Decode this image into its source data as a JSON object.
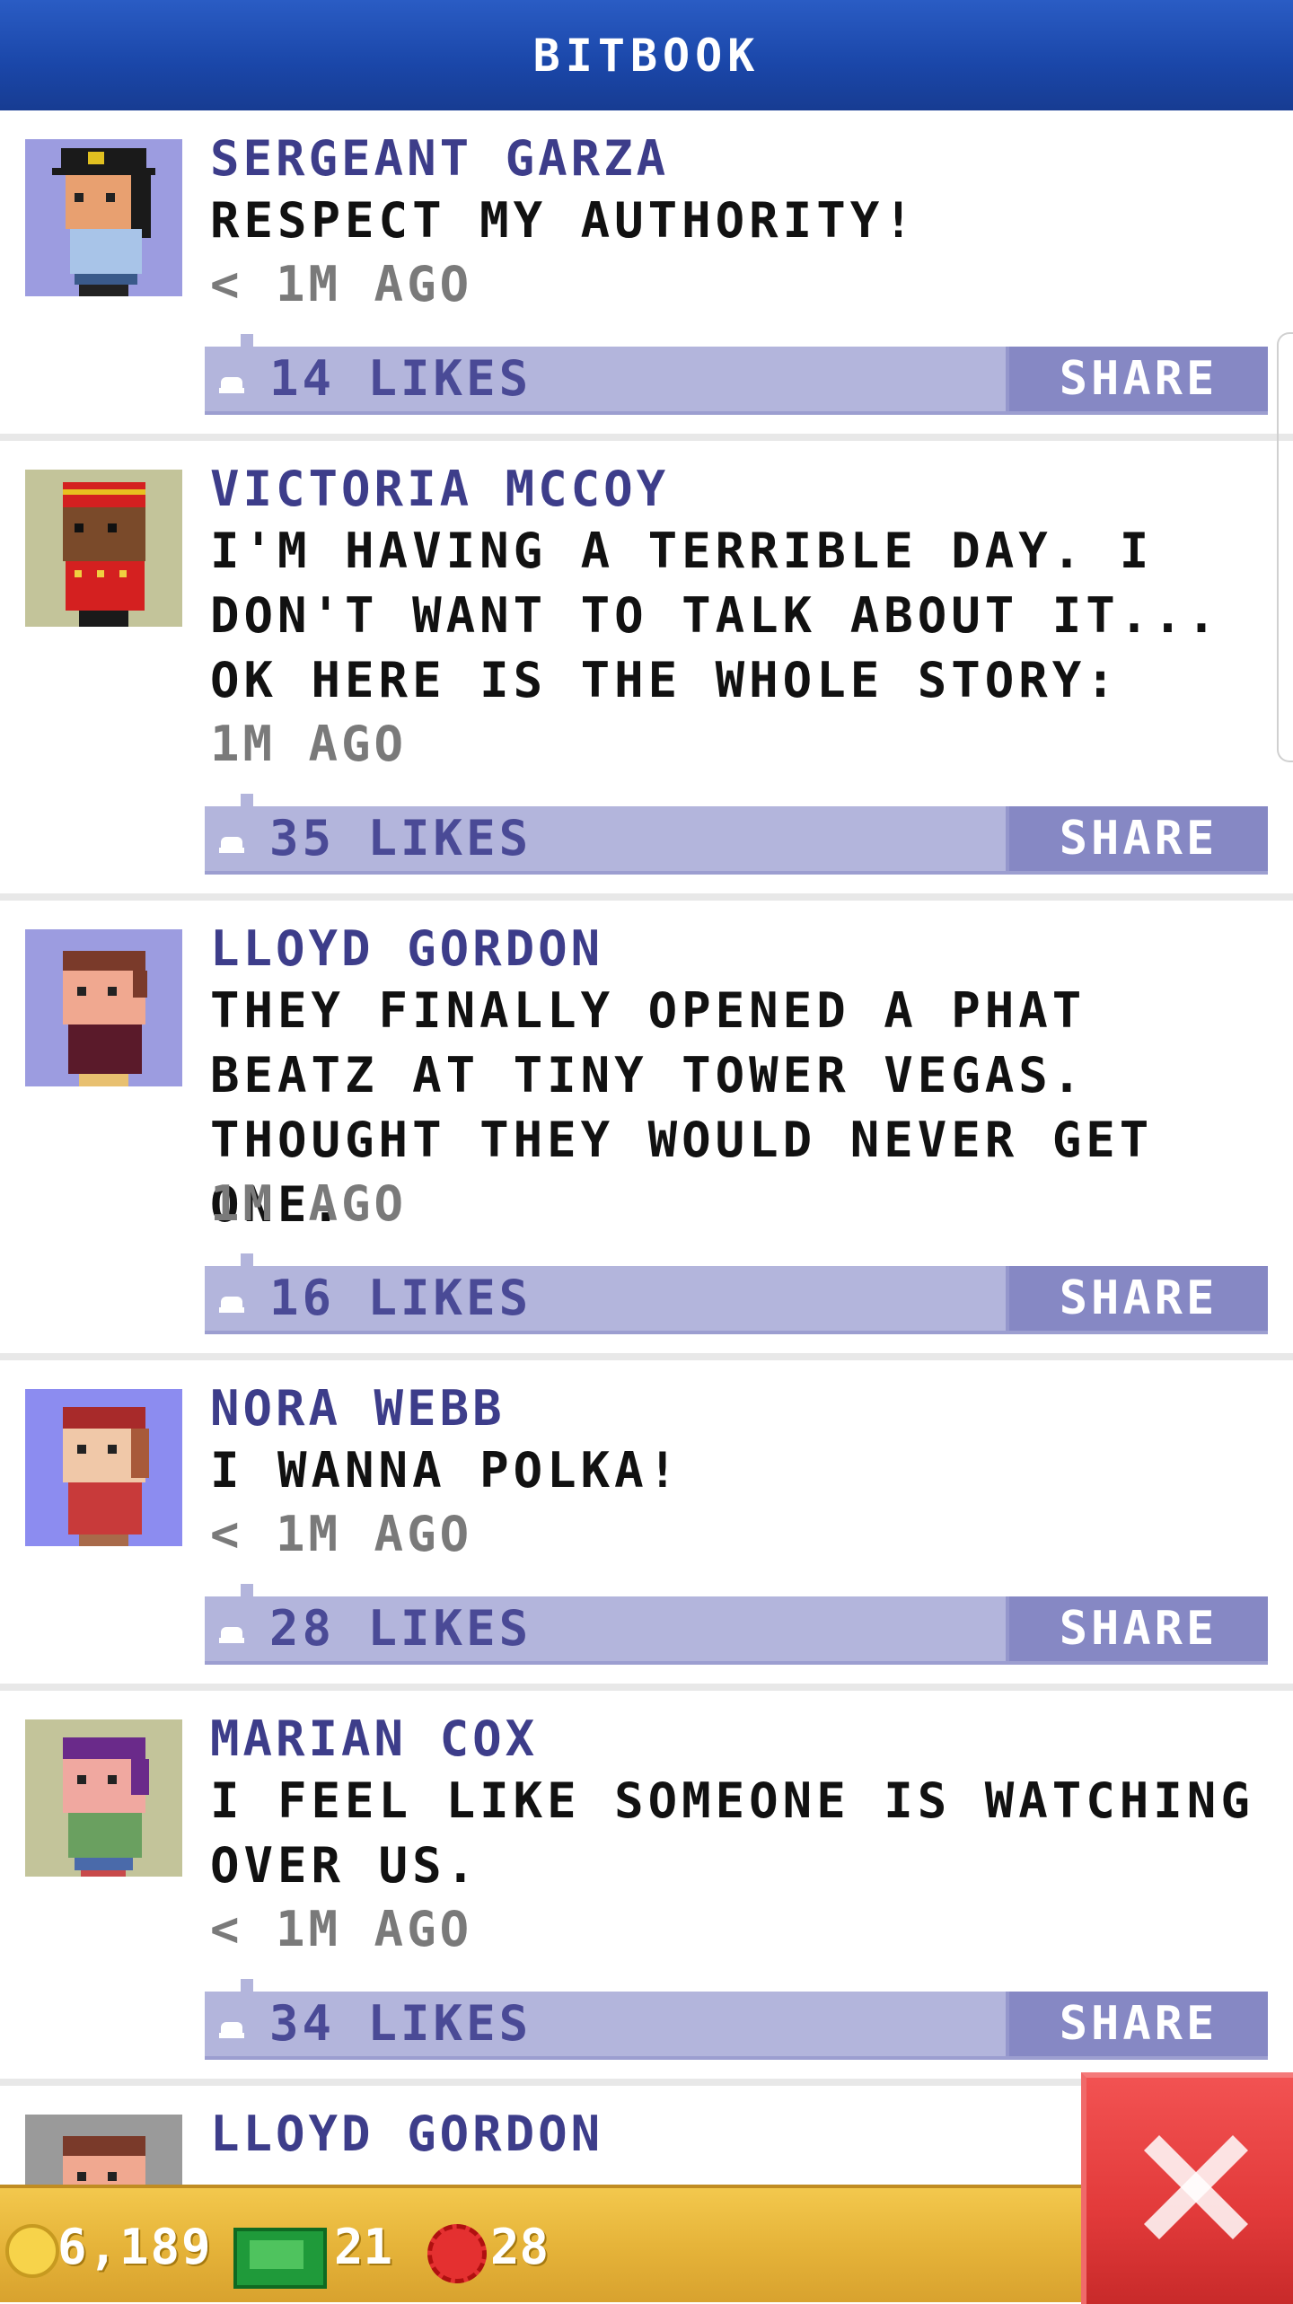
{
  "header": {
    "title": "BITBOOK"
  },
  "posts": [
    {
      "name": "SERGEANT GARZA",
      "message": "RESPECT MY AUTHORITY!",
      "time": "< 1M AGO",
      "likes": "14 LIKES",
      "share": "SHARE",
      "avatar_bg": "#9c9ce0"
    },
    {
      "name": "VICTORIA MCCOY",
      "message": "I'M HAVING A TERRIBLE DAY. I DON'T WANT TO TALK ABOUT IT... OK HERE IS THE WHOLE STORY:",
      "time": "1M AGO",
      "likes": "35 LIKES",
      "share": "SHARE",
      "avatar_bg": "#c3c49a"
    },
    {
      "name": "LLOYD GORDON",
      "message": "THEY FINALLY OPENED A PHAT BEATZ AT TINY TOWER VEGAS. THOUGHT THEY WOULD NEVER GET ONE.",
      "time": "1M AGO",
      "likes": "16 LIKES",
      "share": "SHARE",
      "avatar_bg": "#9c9ce0"
    },
    {
      "name": "NORA WEBB",
      "message": "I WANNA POLKA!",
      "time": "< 1M AGO",
      "likes": "28 LIKES",
      "share": "SHARE",
      "avatar_bg": "#8c8cf0"
    },
    {
      "name": "MARIAN COX",
      "message": "I FEEL LIKE SOMEONE IS WATCHING OVER US.",
      "time": "< 1M AGO",
      "likes": "34 LIKES",
      "share": "SHARE",
      "avatar_bg": "#c3c49a"
    },
    {
      "name": "LLOYD GORDON",
      "message": "",
      "time": "",
      "likes": "",
      "share": "",
      "avatar_bg": "#9a9a9a"
    }
  ],
  "footer": {
    "coins": "6,189",
    "bux": "21",
    "tickets": "28"
  },
  "colors": {
    "header": "#1a46a8",
    "like_bar": "#b3b5dc",
    "share": "#8688c4",
    "footer": "#e6b43a",
    "close": "#e23a3a"
  },
  "icons": {
    "like": "thumbs-up-icon",
    "coin": "coin-icon",
    "bux": "bux-icon",
    "ticket": "ticket-icon",
    "close": "close-icon"
  }
}
